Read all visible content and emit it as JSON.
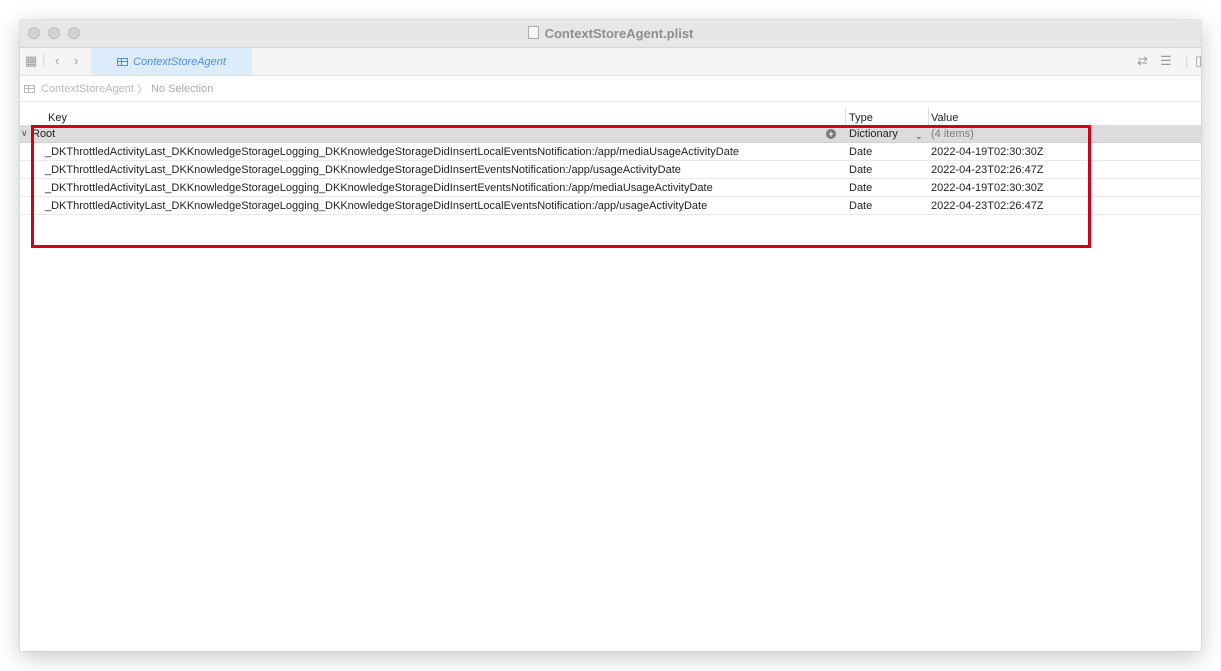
{
  "window": {
    "title": "ContextStoreAgent.plist"
  },
  "tabbar": {
    "active_tab": "ContextStoreAgent",
    "icons": [
      "grid-icon",
      "back-icon",
      "forward-icon",
      "swap-icon",
      "lines-icon",
      "panel-icon"
    ]
  },
  "jumpbar": {
    "file": "ContextStoreAgent",
    "selection": "No Selection"
  },
  "table": {
    "headers": {
      "key": "Key",
      "type": "Type",
      "value": "Value"
    },
    "root": {
      "key": "Root",
      "type": "Dictionary",
      "value": "(4 items)"
    },
    "rows": [
      {
        "key": "_DKThrottledActivityLast_DKKnowledgeStorageLogging_DKKnowledgeStorageDidInsertLocalEventsNotification:/app/mediaUsageActivityDate",
        "type": "Date",
        "value": "2022-04-19T02:30:30Z"
      },
      {
        "key": "_DKThrottledActivityLast_DKKnowledgeStorageLogging_DKKnowledgeStorageDidInsertEventsNotification:/app/usageActivityDate",
        "type": "Date",
        "value": "2022-04-23T02:26:47Z"
      },
      {
        "key": "_DKThrottledActivityLast_DKKnowledgeStorageLogging_DKKnowledgeStorageDidInsertEventsNotification:/app/mediaUsageActivityDate",
        "type": "Date",
        "value": "2022-04-19T02:30:30Z"
      },
      {
        "key": "_DKThrottledActivityLast_DKKnowledgeStorageLogging_DKKnowledgeStorageDidInsertLocalEventsNotification:/app/usageActivityDate",
        "type": "Date",
        "value": "2022-04-23T02:26:47Z"
      }
    ]
  },
  "colors": {
    "highlight_border": "#d0021b",
    "tab_background": "#dcecfb",
    "tab_text": "#4a90e2"
  }
}
